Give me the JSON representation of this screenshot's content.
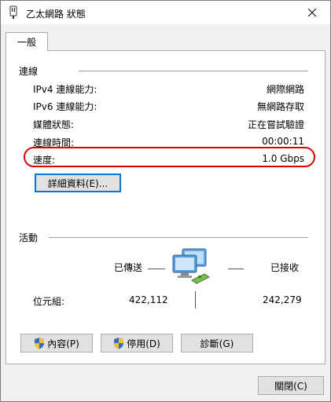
{
  "window": {
    "title": "乙太網路 狀態"
  },
  "tabs": [
    {
      "label": "一般"
    }
  ],
  "connection": {
    "section_title": "連線",
    "rows": [
      {
        "label": "IPv4 連線能力:",
        "value": "網際網路"
      },
      {
        "label": "IPv6 連線能力:",
        "value": "無網路存取"
      },
      {
        "label": "媒體狀態:",
        "value": "正在嘗試驗證"
      },
      {
        "label": "連線時間:",
        "value": "00:00:11"
      },
      {
        "label": "速度:",
        "value": "1.0 Gbps"
      }
    ],
    "details_button": "詳細資料(E)..."
  },
  "activity": {
    "section_title": "活動",
    "sent_label": "已傳送",
    "received_label": "已接收",
    "bytes_label": "位元組:",
    "bytes_sent": "422,112",
    "bytes_received": "242,279"
  },
  "buttons": {
    "properties": "內容(P)",
    "disable": "停用(D)",
    "diagnose": "診斷(G)",
    "close": "關閉(C)"
  },
  "colors": {
    "highlight": "#e00000",
    "accent": "#0078d7"
  }
}
